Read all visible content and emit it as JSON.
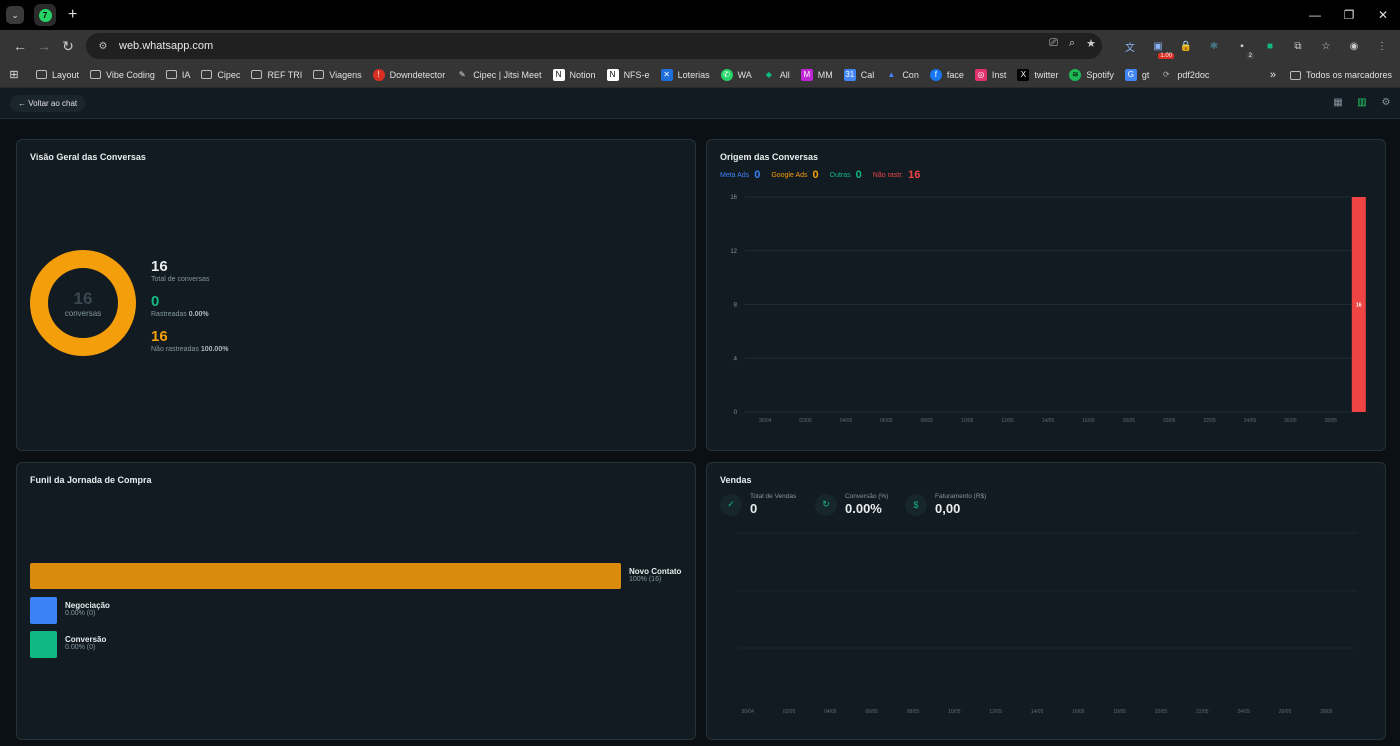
{
  "browser": {
    "tab_counter_icon": "7",
    "url": "web.whatsapp.com",
    "ext_badge_1": "1.00",
    "ext_badge_2": "2",
    "bookmarks": [
      "Layout",
      "Vibe Coding",
      "IA",
      "Cipec",
      "REF TRI",
      "Viagens",
      "Downdetector",
      "Cipec | Jitsi Meet",
      "Notion",
      "NFS-e",
      "Loterias",
      "WA",
      "All",
      "MM",
      "Cal",
      "Con",
      "face",
      "Inst",
      "twitter",
      "Spotify",
      "gt",
      "pdf2doc"
    ],
    "more_bookmarks": "»",
    "all_bookmarks": "Todos os marcadores"
  },
  "app": {
    "back_label": "← Voltar ao chat"
  },
  "overview": {
    "title": "Visão Geral das Conversas",
    "donut_value": "16",
    "donut_label": "conversas",
    "total_value": "16",
    "total_label": "Total de conversas",
    "tracked_value": "0",
    "tracked_label": "Rastreadas",
    "tracked_pct": "0.00%",
    "untracked_value": "16",
    "untracked_label": "Não rastreadas",
    "untracked_pct": "100.00%"
  },
  "origin": {
    "title": "Origem das Conversas",
    "legend": [
      {
        "label": "Meta Ads",
        "value": "0",
        "color": "#3b82f6"
      },
      {
        "label": "Google Ads",
        "value": "0",
        "color": "#f59e0b"
      },
      {
        "label": "Outras",
        "value": "0",
        "color": "#10b981"
      },
      {
        "label": "Não rastr.",
        "value": "16",
        "color": "#ef4444"
      }
    ]
  },
  "chart_data": [
    {
      "type": "bar",
      "title": "Origem das Conversas",
      "categories": [
        "30/04",
        "02/05",
        "04/05",
        "06/05",
        "08/05",
        "10/05",
        "12/05",
        "14/05",
        "16/05",
        "18/05",
        "20/05",
        "22/05",
        "24/05",
        "26/05",
        "28/05"
      ],
      "yticks": [
        0,
        4,
        8,
        12,
        16
      ],
      "ylim": [
        0,
        16
      ],
      "bar": {
        "label": "28/05",
        "value": 16,
        "color": "#ef4444",
        "data_label": "16"
      },
      "legend_placement": "top-left"
    },
    {
      "type": "line",
      "title": "Vendas",
      "categories": [
        "30/04",
        "02/05",
        "04/05",
        "06/05",
        "08/05",
        "10/05",
        "12/05",
        "14/05",
        "16/05",
        "18/05",
        "20/05",
        "22/05",
        "24/05",
        "26/05",
        "28/05"
      ],
      "values": [],
      "grid": true
    }
  ],
  "funnel": {
    "title": "Funil da Jornada de Compra",
    "stages": [
      {
        "name": "Novo Contato",
        "sub": "100% (16)",
        "pct": 100,
        "color": "#d98c0b"
      },
      {
        "name": "Negociação",
        "sub": "0.00% (0)",
        "pct": 0,
        "color": "#3b82f6"
      },
      {
        "name": "Conversão",
        "sub": "0.00% (0)",
        "pct": 0,
        "color": "#10b981"
      }
    ]
  },
  "sales": {
    "title": "Vendas",
    "kpis": [
      {
        "label": "Total de Vendas",
        "value": "0",
        "icon": "check-icon"
      },
      {
        "label": "Conversão (%)",
        "value": "0.00%",
        "icon": "refresh-icon"
      },
      {
        "label": "Faturamento (R$)",
        "value": "0,00",
        "icon": "dollar-icon"
      }
    ]
  },
  "colors": {
    "accent": "#25d366",
    "tracked": "#10b981",
    "untracked": "#f59e0b"
  }
}
